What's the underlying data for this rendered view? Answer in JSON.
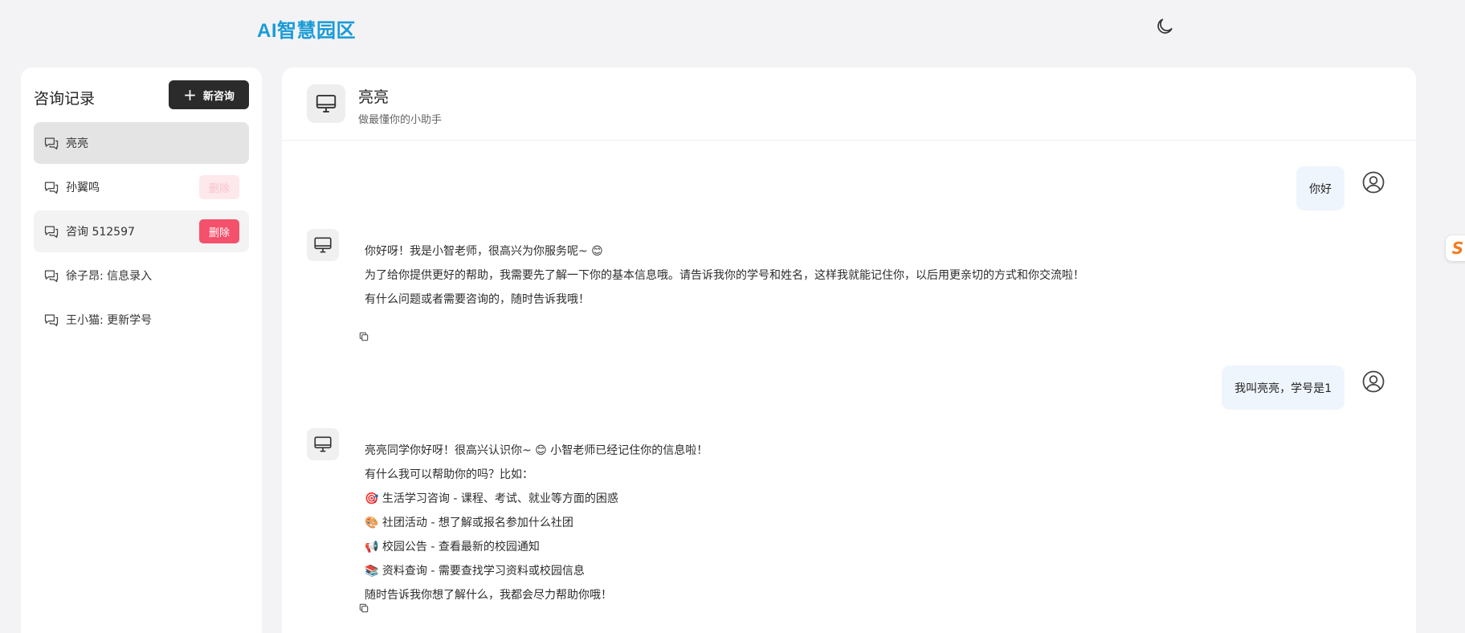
{
  "app": {
    "logo": "AI智慧园区"
  },
  "sidebar": {
    "title": "咨询记录",
    "new_button_label": "新咨询",
    "items": [
      {
        "label": "亮亮",
        "state": "active",
        "delete_label": ""
      },
      {
        "label": "孙翼鸣",
        "state": "normal",
        "delete_label": "删除"
      },
      {
        "label": "咨询 512597",
        "state": "hover",
        "delete_label": "删除"
      },
      {
        "label": "徐子昂: 信息录入",
        "state": "normal",
        "delete_label": ""
      },
      {
        "label": "王小猫: 更新学号",
        "state": "normal",
        "delete_label": ""
      }
    ]
  },
  "chat": {
    "name": "亮亮",
    "subtitle": "做最懂你的小助手",
    "messages": [
      {
        "role": "user",
        "text": "你好"
      },
      {
        "role": "bot",
        "lines": [
          "你好呀！我是小智老师，很高兴为你服务呢~ 😊",
          "为了给你提供更好的帮助，我需要先了解一下你的基本信息哦。请告诉我你的学号和姓名，这样我就能记住你，以后用更亲切的方式和你交流啦！",
          "有什么问题或者需要咨询的，随时告诉我哦！"
        ]
      },
      {
        "role": "user",
        "text": "我叫亮亮，学号是1"
      },
      {
        "role": "bot",
        "intro": "亮亮同学你好呀！很高兴认识你~ 😊 小智老师已经记住你的信息啦！",
        "question": "有什么我可以帮助你的吗？比如：",
        "items": [
          "🎯 生活学习咨询 - 课程、考试、就业等方面的困惑",
          "🎨 社团活动 - 想了解或报名参加什么社团",
          "📢 校园公告 - 查看最新的校园通知",
          "📚 资料查询 - 需要查找学习资料或校园信息"
        ],
        "outro": "随时告诉我你想了解什么，我都会尽力帮助你哦！"
      }
    ]
  },
  "float_badge": {
    "text": "S"
  }
}
